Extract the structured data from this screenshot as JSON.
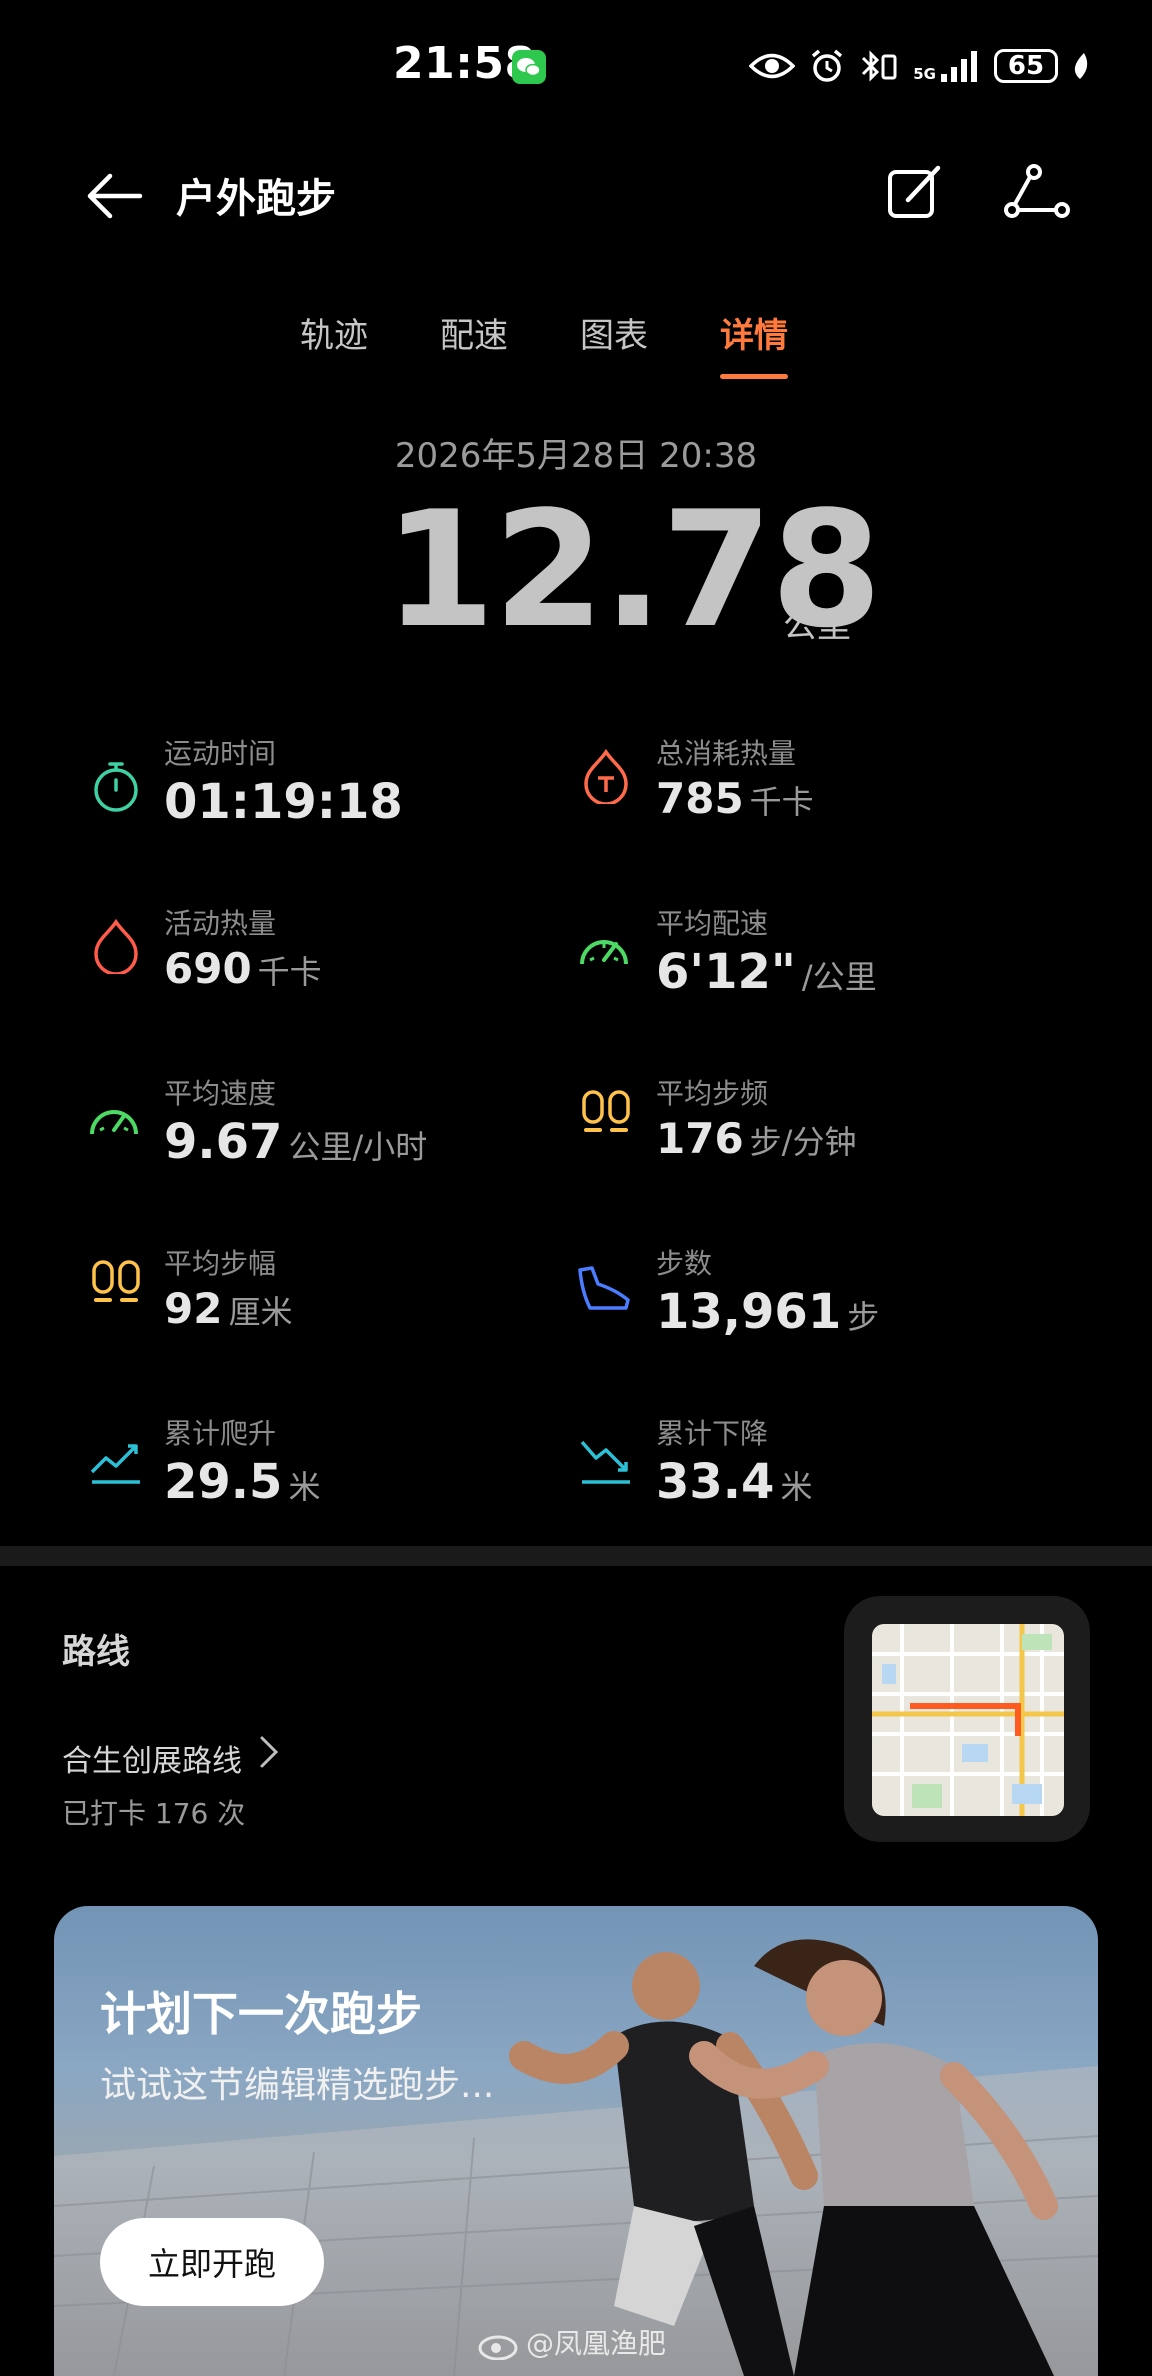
{
  "status_bar": {
    "time": "21:58",
    "network": "5G",
    "battery": "65"
  },
  "header": {
    "title": "户外跑步"
  },
  "tabs": [
    {
      "label": "轨迹"
    },
    {
      "label": "配速"
    },
    {
      "label": "图表"
    },
    {
      "label": "详情",
      "active": true
    }
  ],
  "summary": {
    "datetime": "2026年5月28日 20:38",
    "distance": "12.78",
    "distance_unit": "公里"
  },
  "metrics": [
    {
      "label": "运动时间",
      "value": "01:19:18",
      "unit": "",
      "icon": "stopwatch-icon",
      "color": "#3fd1a4"
    },
    {
      "label": "总消耗热量",
      "value": "785",
      "unit": "千卡",
      "icon": "calorie-flame-icon",
      "color": "#ff6a4a"
    },
    {
      "label": "活动热量",
      "value": "690",
      "unit": "千卡",
      "icon": "flame-icon",
      "color": "#ff5a4a"
    },
    {
      "label": "平均配速",
      "value": "6'12\"",
      "unit": "/公里",
      "icon": "pace-gauge-icon",
      "color": "#4cd964"
    },
    {
      "label": "平均速度",
      "value": "9.67",
      "unit": "公里/小时",
      "icon": "speed-gauge-icon",
      "color": "#4cd964"
    },
    {
      "label": "平均步频",
      "value": "176",
      "unit": "步/分钟",
      "icon": "footprints-icon",
      "color": "#ffc24a"
    },
    {
      "label": "平均步幅",
      "value": "92",
      "unit": "厘米",
      "icon": "stride-footprints-icon",
      "color": "#ffc24a"
    },
    {
      "label": "步数",
      "value": "13,961",
      "unit": "步",
      "icon": "shoe-icon",
      "color": "#4a7dff"
    },
    {
      "label": "累计爬升",
      "value": "29.5",
      "unit": "米",
      "icon": "ascent-icon",
      "color": "#2cc0d6"
    },
    {
      "label": "累计下降",
      "value": "33.4",
      "unit": "米",
      "icon": "descent-icon",
      "color": "#2cc0d6"
    }
  ],
  "route": {
    "title": "路线",
    "name": "合生创展路线",
    "count": "已打卡 176 次"
  },
  "banner": {
    "title": "计划下一次跑步",
    "subtitle": "试试这节编辑精选跑步...",
    "cta": "立即开跑"
  },
  "watermark": "@凤凰渔肥",
  "colors": {
    "accent": "#ff7a3c",
    "background": "#000000"
  }
}
